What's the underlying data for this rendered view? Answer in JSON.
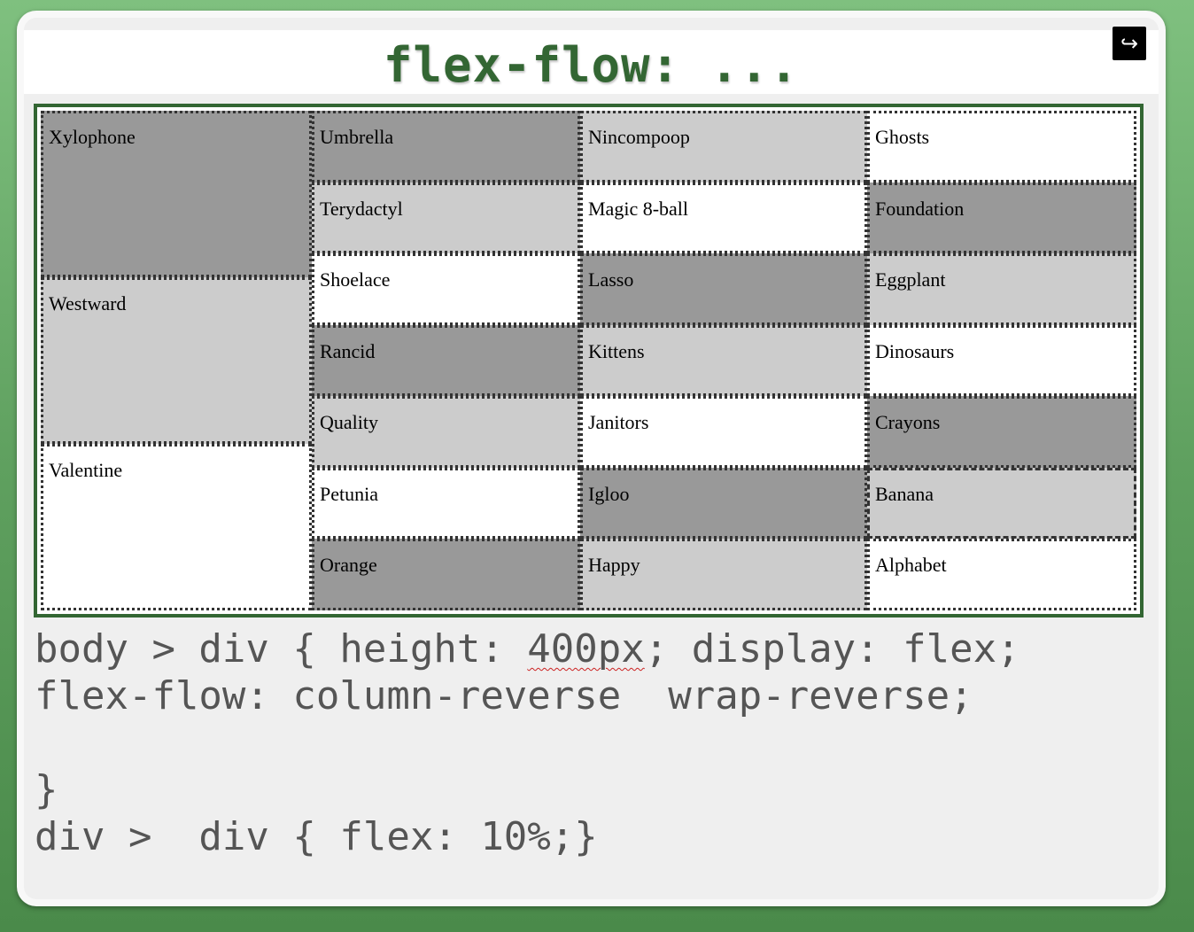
{
  "title": "flex-flow: ...",
  "back_icon": "↪",
  "columns": [
    [
      {
        "label": "Xylophone",
        "shade": "dark"
      },
      {
        "label": "Westward",
        "shade": "light"
      },
      {
        "label": "Valentine",
        "shade": "white"
      }
    ],
    [
      {
        "label": "Umbrella",
        "shade": "dark"
      },
      {
        "label": "Terydactyl",
        "shade": "light"
      },
      {
        "label": "Shoelace",
        "shade": "white"
      },
      {
        "label": "Rancid",
        "shade": "dark"
      },
      {
        "label": "Quality",
        "shade": "light"
      },
      {
        "label": "Petunia",
        "shade": "white"
      },
      {
        "label": "Orange",
        "shade": "dark"
      }
    ],
    [
      {
        "label": "Nincompoop",
        "shade": "light"
      },
      {
        "label": "Magic 8-ball",
        "shade": "white"
      },
      {
        "label": "Lasso",
        "shade": "dark"
      },
      {
        "label": "Kittens",
        "shade": "light"
      },
      {
        "label": "Janitors",
        "shade": "white"
      },
      {
        "label": "Igloo",
        "shade": "dark"
      },
      {
        "label": "Happy",
        "shade": "light"
      }
    ],
    [
      {
        "label": "Ghosts",
        "shade": "white"
      },
      {
        "label": "Foundation",
        "shade": "dark"
      },
      {
        "label": "Eggplant",
        "shade": "light"
      },
      {
        "label": "Dinosaurs",
        "shade": "white"
      },
      {
        "label": "Crayons",
        "shade": "dark"
      },
      {
        "label": "Banana",
        "shade": "light",
        "dashed": true
      },
      {
        "label": "Alphabet",
        "shade": "white"
      }
    ]
  ],
  "code": {
    "line1_a": "body > div { height: ",
    "line1_b": "400px",
    "line1_c": "; display: flex;",
    "line2": "flex-flow: column-reverse  wrap-reverse;",
    "line3": "",
    "line4": "}",
    "line5": "div >  div { flex: 10%;}"
  }
}
